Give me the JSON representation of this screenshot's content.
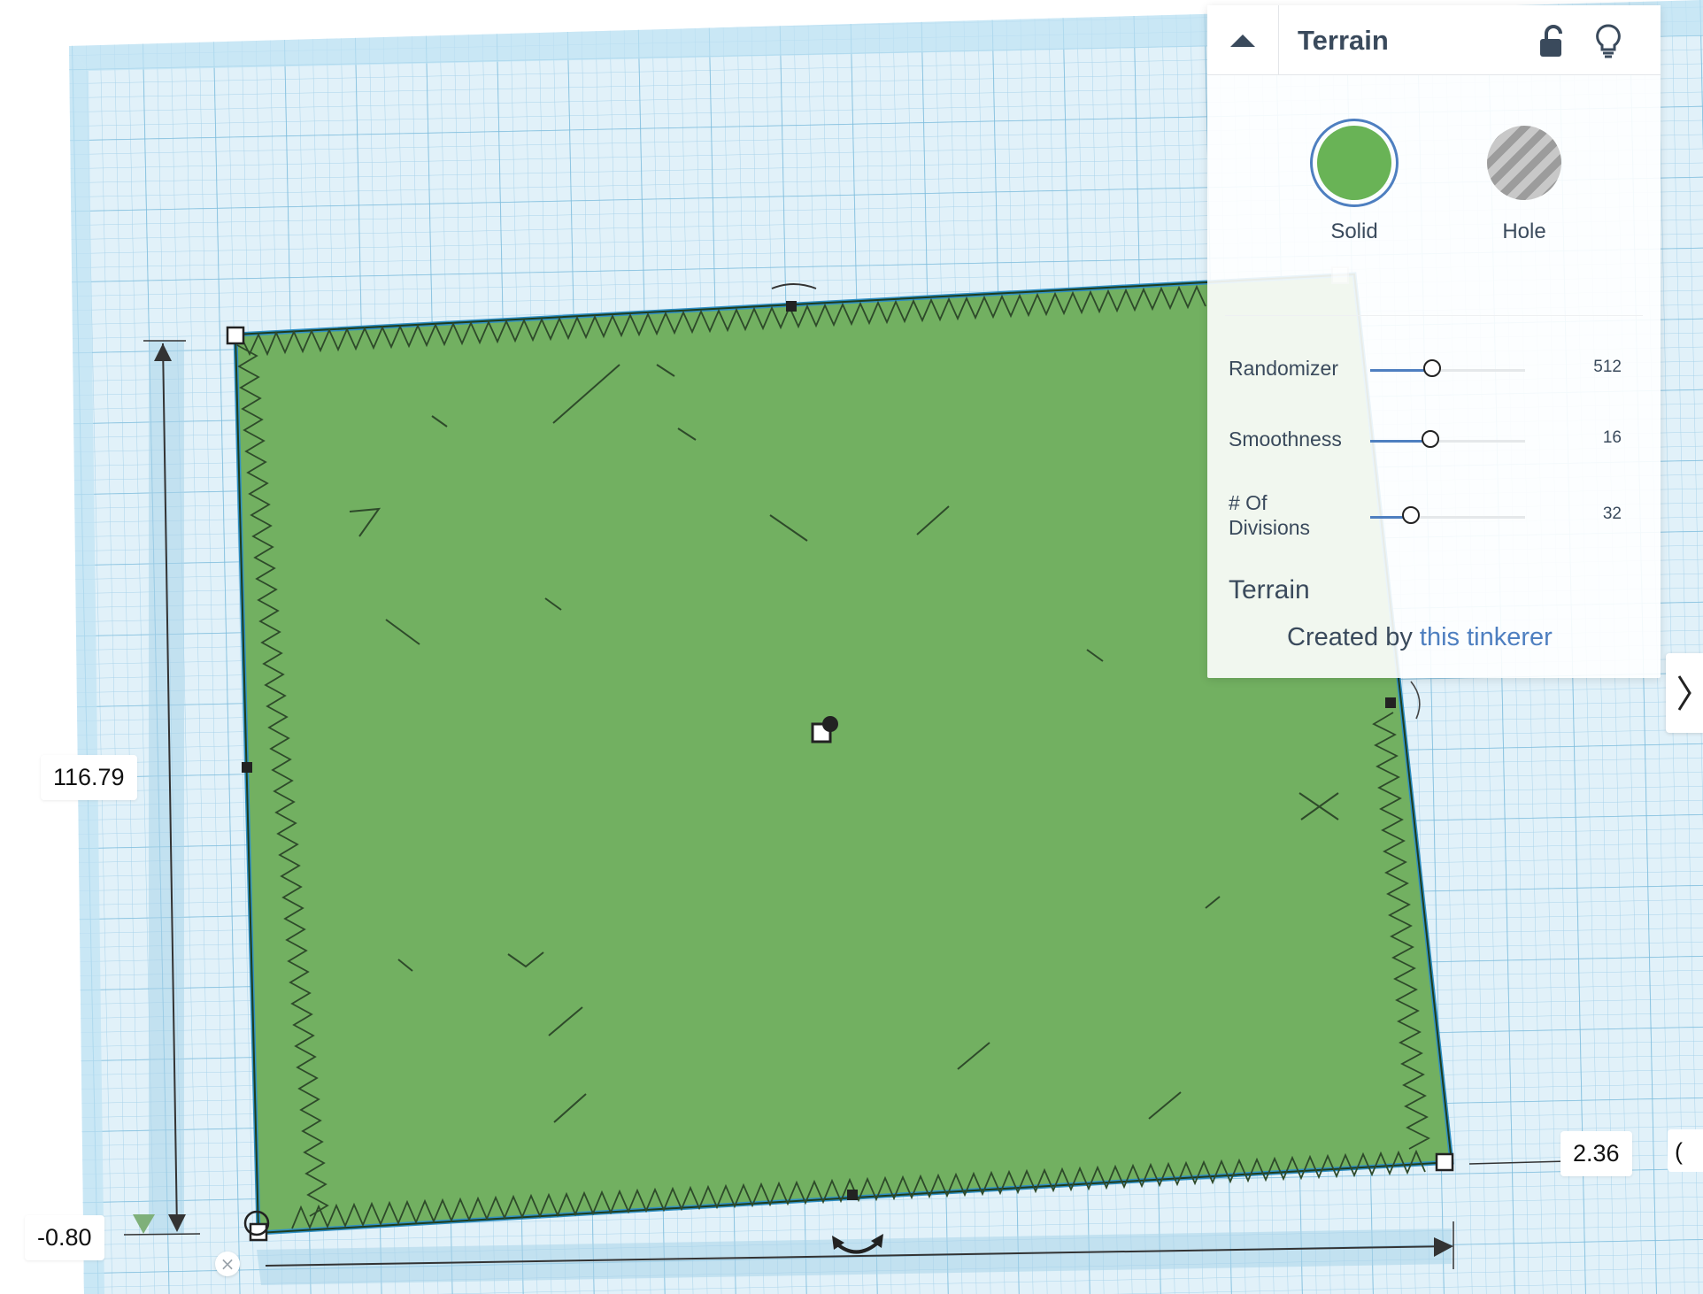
{
  "viewport": {
    "dimensions": {
      "height": "116.79",
      "elevation": "-0.80",
      "width": "2.36",
      "partial_label": "("
    },
    "close_label": "×",
    "workplane_color": "#d9eef8",
    "shape_color": "#69b356"
  },
  "inspector": {
    "title": "Terrain",
    "icons": {
      "collapse": "chevron-up-icon",
      "lock": "unlock-icon",
      "hint": "lightbulb-icon"
    },
    "modes": {
      "solid": {
        "label": "Solid",
        "color": "#69b356",
        "selected": true
      },
      "hole": {
        "label": "Hole",
        "selected": false
      }
    },
    "params": {
      "randomizer": {
        "label": "Randomizer",
        "value": "512",
        "fill": 0.4
      },
      "smoothness": {
        "label": "Smoothness",
        "value": "16",
        "fill": 0.39
      },
      "divisions": {
        "label": "# Of\nDivisions",
        "value": "32",
        "fill": 0.26
      }
    },
    "shape_name": "Terrain",
    "credit": {
      "prefix": "Created by ",
      "link": "this tinkerer"
    }
  },
  "panel_toggle_icon": "chevron-right-icon",
  "accent_color": "#4e7fc0"
}
